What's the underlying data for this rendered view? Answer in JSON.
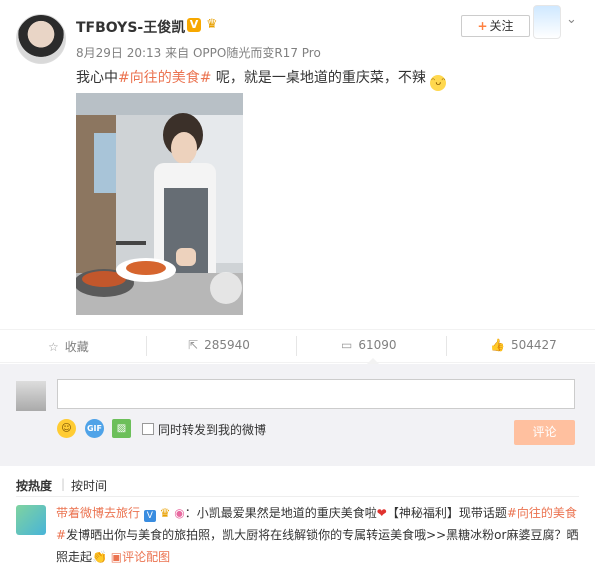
{
  "post": {
    "username": "TFBOYS-王俊凯",
    "verified_badge": "V",
    "time": "8月29日 20:13",
    "source_prefix": "来自",
    "source": "OPPO随光而变R17 Pro",
    "follow_plus": "+",
    "follow_label": "关注",
    "text_before": "我心中",
    "topic": "#向往的美食#",
    "text_after": " 呢，就是一桌地道的重庆菜，不辣"
  },
  "actions": {
    "favorite_label": "收藏",
    "repost_count": "285940",
    "comment_count": "61090",
    "like_count": "504427"
  },
  "comment_box": {
    "emoji_label": "☺",
    "gif_label": "GIF",
    "forward_label": "同时转发到我的微博",
    "submit_label": "评论"
  },
  "sort": {
    "by_heat": "按热度",
    "by_time": "按时间"
  },
  "featured_comment": {
    "user": "带着微博去旅行",
    "v": "V",
    "text1": "：小凯最爱果然是地道的重庆美食啦",
    "text2": "【神秘福利】现带话题",
    "topic": "#向往的美食#",
    "text3": "发博晒出你与美食的旅拍照，凯大厨将在线解锁你的专属转运美食哦>>黑糖冰粉or麻婆豆腐？晒照走起",
    "pic_link": "评论配图"
  },
  "icons": {
    "star": "star-icon",
    "repost": "repost-icon",
    "comment": "comment-icon",
    "like": "like-icon"
  },
  "colors": {
    "topic": "#eb7350",
    "follow_plus": "#ff8140",
    "submit_bg": "#ffc09f",
    "comment_box_bg": "#f2f2f5"
  }
}
